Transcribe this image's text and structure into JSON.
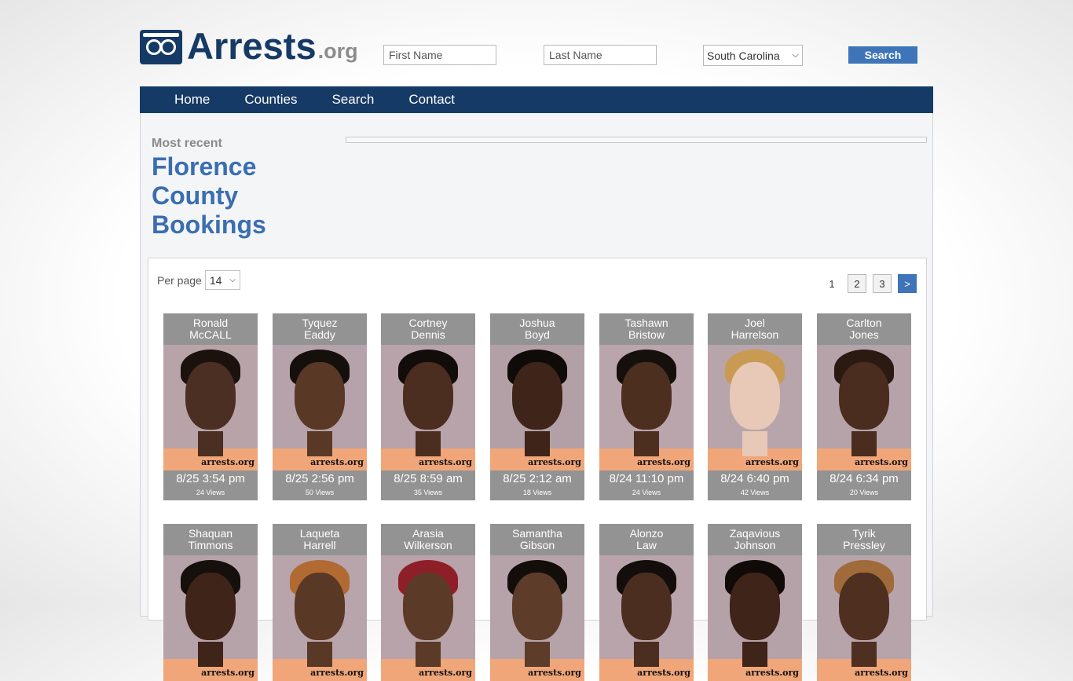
{
  "header": {
    "logo_main": "Arrests",
    "logo_tld": ".org",
    "first_name_placeholder": "First Name",
    "last_name_placeholder": "Last Name",
    "state_selected": "South Carolina",
    "search_label": "Search"
  },
  "nav": {
    "items": [
      "Home",
      "Counties",
      "Search",
      "Contact"
    ]
  },
  "section": {
    "subtitle": "Most recent",
    "title": "Florence County Bookings"
  },
  "listing": {
    "per_page_label": "Per page",
    "per_page_value": "14",
    "pages": [
      "1",
      "2",
      "3"
    ],
    "next_label": ">"
  },
  "watermark": "arrests.org",
  "bookings": [
    {
      "first": "Ronald",
      "last": "McCALL",
      "date": "8/25 3:54 pm",
      "views": "24 Views",
      "skin": "#4a2f22",
      "hair": "#1b120d",
      "bg": "#b8a4a8"
    },
    {
      "first": "Tyquez",
      "last": "Eaddy",
      "date": "8/25 2:56 pm",
      "views": "50 Views",
      "skin": "#5a3826",
      "hair": "#16100c",
      "bg": "#b5a2aa"
    },
    {
      "first": "Cortney",
      "last": "Dennis",
      "date": "8/25 8:59 am",
      "views": "35 Views",
      "skin": "#4b2e20",
      "hair": "#120c0a",
      "bg": "#b7a3a9"
    },
    {
      "first": "Joshua",
      "last": "Boyd",
      "date": "8/25 2:12 am",
      "views": "18 Views",
      "skin": "#3e2419",
      "hair": "#0f0b09",
      "bg": "#b3a0a6"
    },
    {
      "first": "Tashawn",
      "last": "Bristow",
      "date": "8/24 11:10 pm",
      "views": "24 Views",
      "skin": "#4d2f20",
      "hair": "#15100c",
      "bg": "#b9a5ab"
    },
    {
      "first": "Joel",
      "last": "Harrelson",
      "date": "8/24 6:40 pm",
      "views": "42 Views",
      "skin": "#e8c8b6",
      "hair": "#c99a52",
      "bg": "#b8a5ab"
    },
    {
      "first": "Carlton",
      "last": "Jones",
      "date": "8/24 6:34 pm",
      "views": "20 Views",
      "skin": "#4a2d1f",
      "hair": "#2a1a12",
      "bg": "#b6a3a9"
    },
    {
      "first": "Shaquan",
      "last": "Timmons",
      "date": "",
      "views": "",
      "skin": "#3f2519",
      "hair": "#15100c",
      "bg": "#b6a3a9"
    },
    {
      "first": "Laqueta",
      "last": "Harrell",
      "date": "",
      "views": "",
      "skin": "#5a3826",
      "hair": "#b06a32",
      "bg": "#b8a5ab"
    },
    {
      "first": "Arasia",
      "last": "Wilkerson",
      "date": "",
      "views": "",
      "skin": "#5b3a28",
      "hair": "#8e1f28",
      "bg": "#b7a3a9"
    },
    {
      "first": "Samantha",
      "last": "Gibson",
      "date": "",
      "views": "",
      "skin": "#5e3c2a",
      "hair": "#140e0b",
      "bg": "#b6a3a9"
    },
    {
      "first": "Alonzo",
      "last": "Law",
      "date": "",
      "views": "",
      "skin": "#4b2e20",
      "hair": "#130e0b",
      "bg": "#b8a4aa"
    },
    {
      "first": "Zaqavious",
      "last": "Johnson",
      "date": "",
      "views": "",
      "skin": "#3e2419",
      "hair": "#100b09",
      "bg": "#b5a2a8"
    },
    {
      "first": "Tyrik",
      "last": "Pressley",
      "date": "",
      "views": "",
      "skin": "#4e2f20",
      "hair": "#a06a3a",
      "bg": "#b7a4aa"
    }
  ]
}
